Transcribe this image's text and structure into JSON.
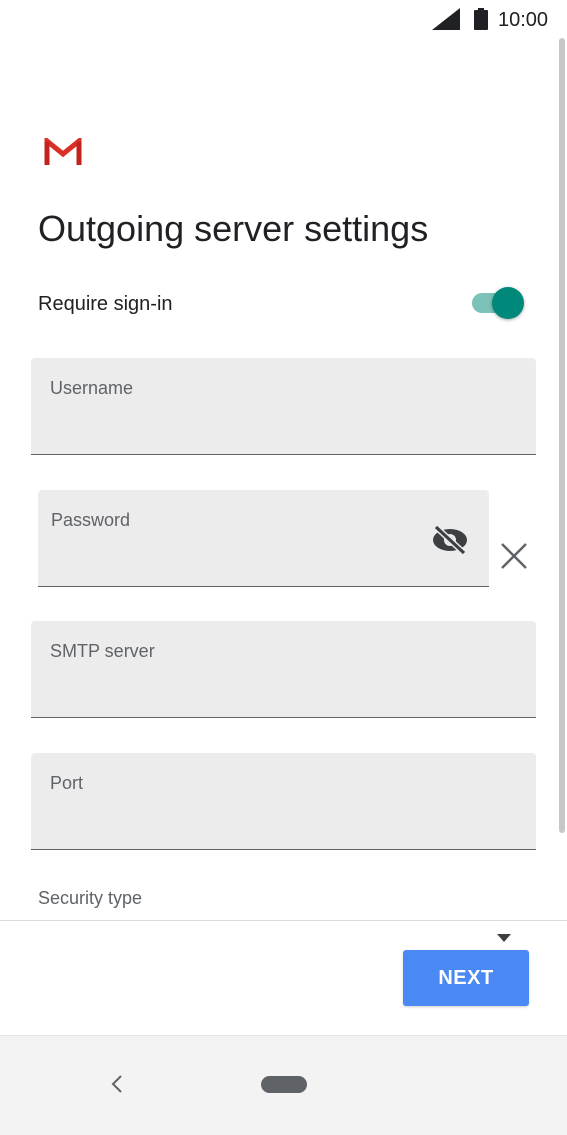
{
  "status_bar": {
    "time": "10:00",
    "icons": [
      "signal-icon",
      "battery-icon"
    ]
  },
  "app": {
    "logo": "gmail-logo",
    "title": "Outgoing server settings"
  },
  "require_signin": {
    "label": "Require sign-in",
    "enabled": true
  },
  "fields": {
    "username": {
      "label": "Username",
      "value": ""
    },
    "password": {
      "label": "Password",
      "value": ""
    },
    "smtp": {
      "label": "SMTP server",
      "value": ""
    },
    "port": {
      "label": "Port",
      "value": ""
    }
  },
  "security": {
    "label": "Security type"
  },
  "actions": {
    "next_label": "NEXT"
  },
  "nav": {
    "icons": [
      "back-icon",
      "home-pill"
    ]
  },
  "colors": {
    "accent": "#00897b",
    "button": "#4a89f3",
    "field_bg": "#ececec"
  }
}
